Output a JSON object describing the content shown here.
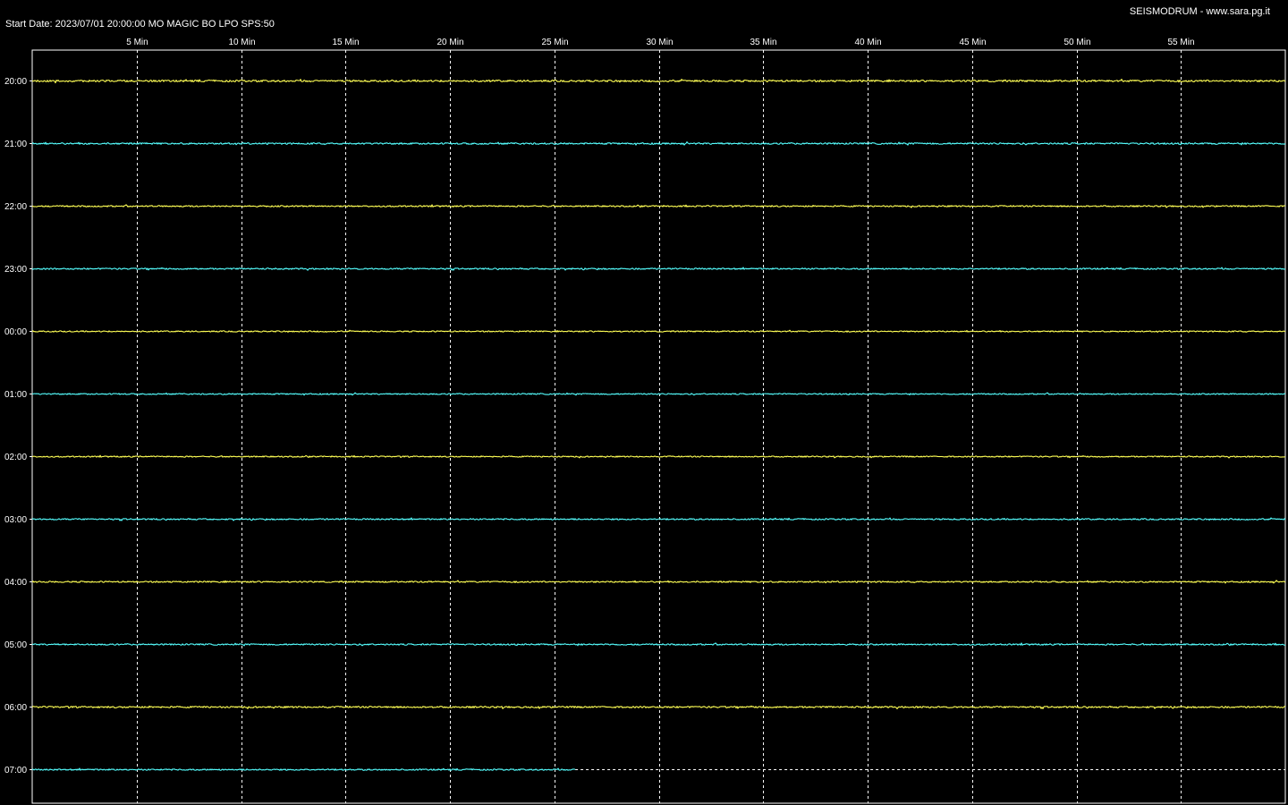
{
  "header": {
    "start_info": "Start Date: 2023/07/01 20:00:00 MO MAGIC BO LPO SPS:50",
    "brand": "SEISMODRUM - www.sara.pg.it"
  },
  "chart_data": {
    "type": "line",
    "title": "",
    "xlabel": "",
    "ylabel": "",
    "x_range_minutes": [
      0,
      60
    ],
    "x_ticks": [
      {
        "minute": 5,
        "label": "5 Min"
      },
      {
        "minute": 10,
        "label": "10 Min"
      },
      {
        "minute": 15,
        "label": "15 Min"
      },
      {
        "minute": 20,
        "label": "20 Min"
      },
      {
        "minute": 25,
        "label": "25 Min"
      },
      {
        "minute": 30,
        "label": "30 Min"
      },
      {
        "minute": 35,
        "label": "35 Min"
      },
      {
        "minute": 40,
        "label": "40 Min"
      },
      {
        "minute": 45,
        "label": "45 Min"
      },
      {
        "minute": 50,
        "label": "50 Min"
      },
      {
        "minute": 55,
        "label": "55 Min"
      }
    ],
    "vertical_grid": "dashed",
    "background": "#000000",
    "rows": [
      {
        "label": "20:00",
        "color": "#ffff55",
        "end_minute": 60,
        "noise_level": 0.45
      },
      {
        "label": "21:00",
        "color": "#55ffff",
        "end_minute": 60,
        "noise_level": 0.4
      },
      {
        "label": "22:00",
        "color": "#ffff55",
        "end_minute": 60,
        "noise_level": 0.35
      },
      {
        "label": "23:00",
        "color": "#55ffff",
        "end_minute": 60,
        "noise_level": 0.35
      },
      {
        "label": "00:00",
        "color": "#ffff55",
        "end_minute": 60,
        "noise_level": 0.3
      },
      {
        "label": "01:00",
        "color": "#55ffff",
        "end_minute": 60,
        "noise_level": 0.3
      },
      {
        "label": "02:00",
        "color": "#ffff55",
        "end_minute": 60,
        "noise_level": 0.3
      },
      {
        "label": "03:00",
        "color": "#55ffff",
        "end_minute": 60,
        "noise_level": 0.35
      },
      {
        "label": "04:00",
        "color": "#ffff55",
        "end_minute": 60,
        "noise_level": 0.35
      },
      {
        "label": "05:00",
        "color": "#55ffff",
        "end_minute": 60,
        "noise_level": 0.35
      },
      {
        "label": "06:00",
        "color": "#ffff55",
        "end_minute": 60,
        "noise_level": 0.4
      },
      {
        "label": "07:00",
        "color": "#55ffff",
        "end_minute": 26,
        "noise_level": 0.35
      }
    ]
  }
}
